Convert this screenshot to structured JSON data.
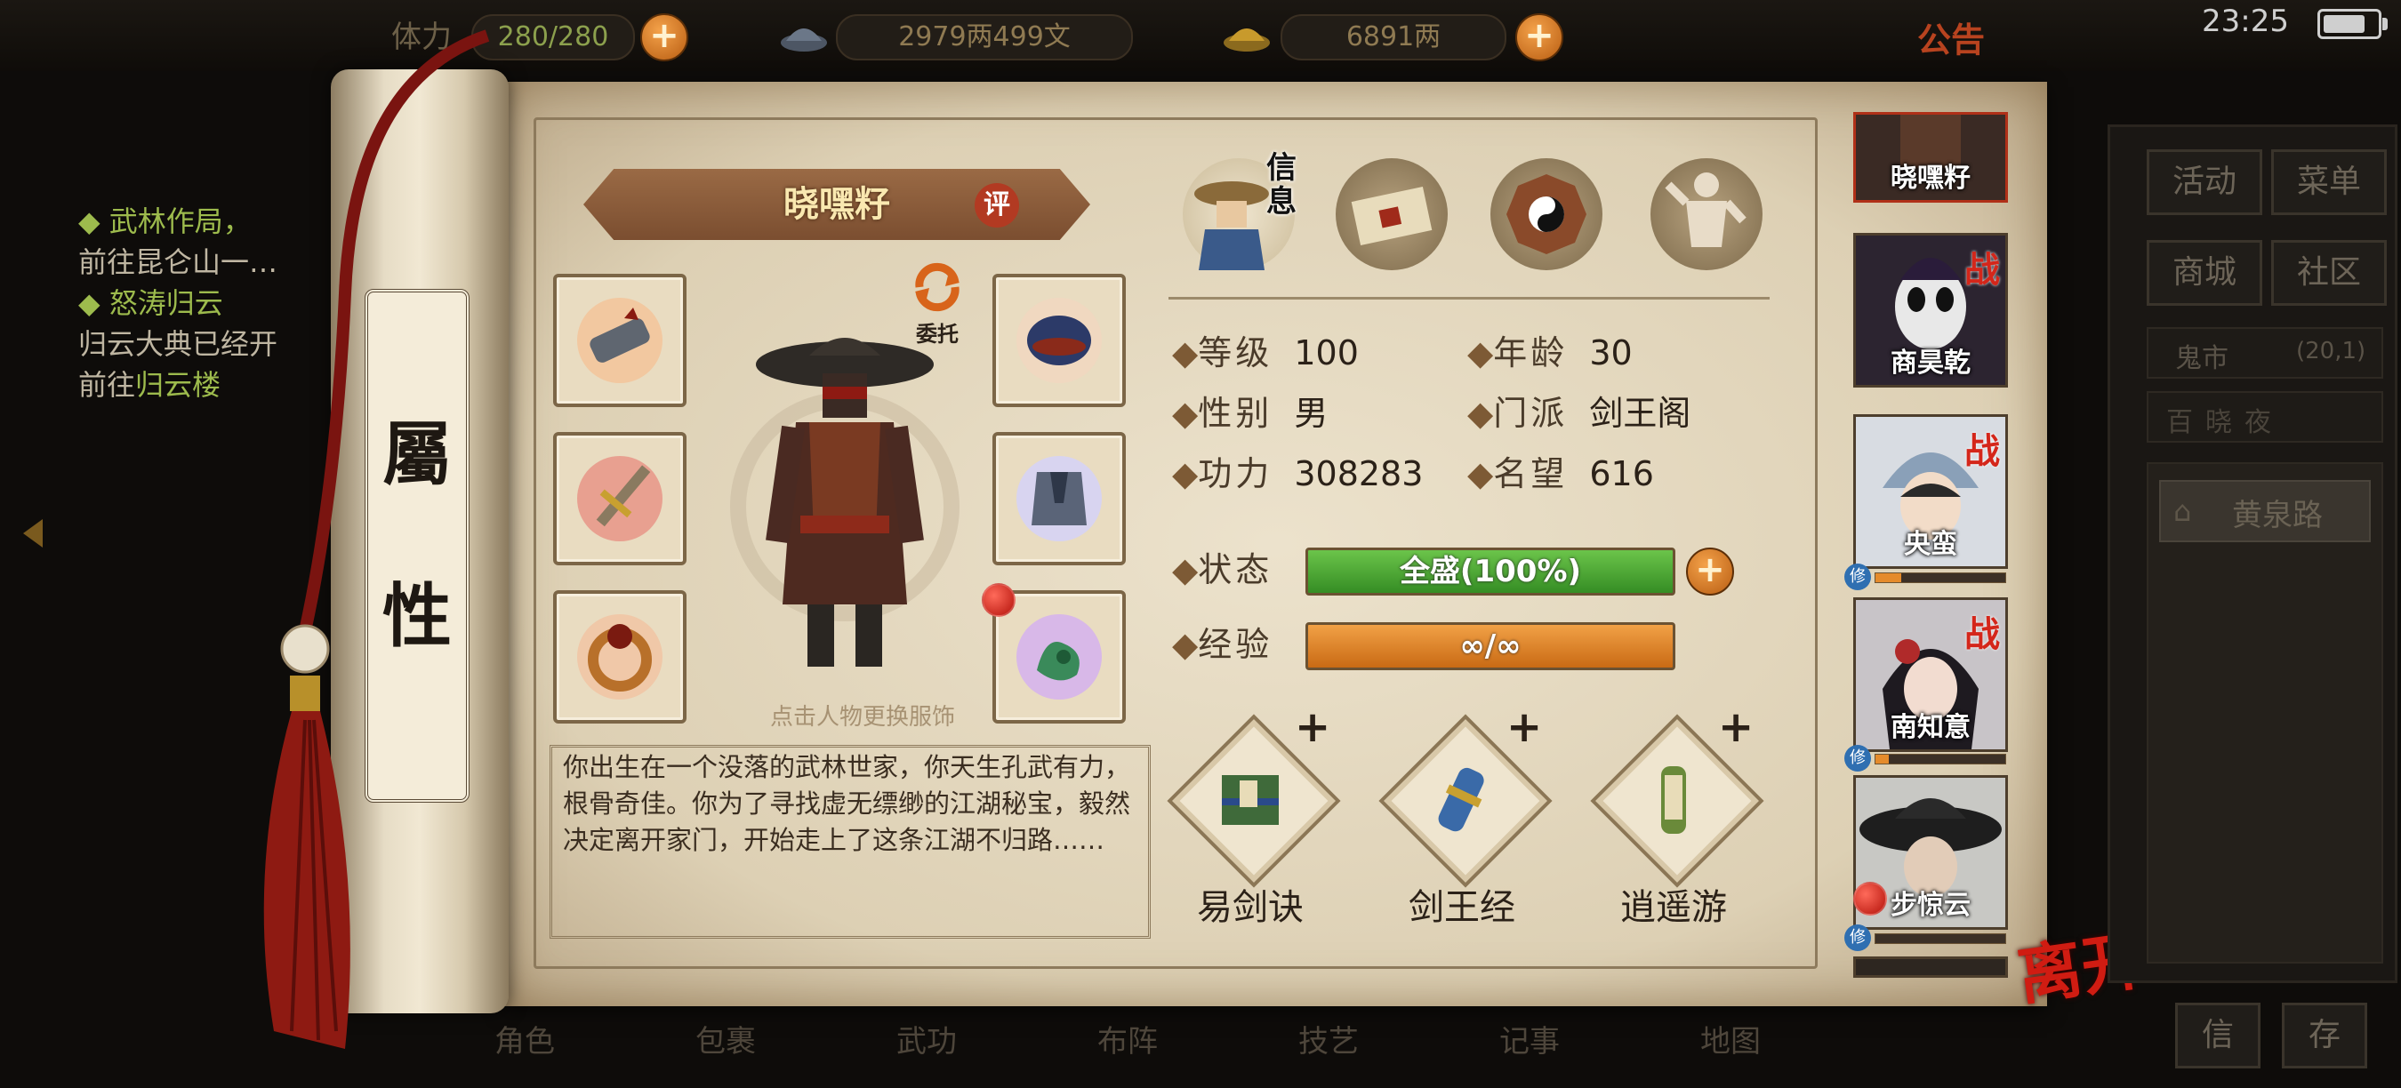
{
  "topbar": {
    "stamina_label": "体力",
    "stamina_value": "280/280",
    "silver_value": "2979两499文",
    "gold_value": "6891两",
    "announcement_label": "公告",
    "clock": "23:25"
  },
  "quests": [
    {
      "title": "武林作局，",
      "text": "前往昆仑山一…"
    },
    {
      "title": "怒涛归云",
      "text": "归云大典已经开",
      "link_prefix": "前往",
      "link": "归云楼"
    }
  ],
  "scroll": {
    "title_chars": [
      "屬",
      "性"
    ]
  },
  "character": {
    "name": "晓嘿籽",
    "rate_label": "评",
    "entrust_label": "委托",
    "hint": "点击人物更换服饰",
    "description": "你出生在一个没落的武林世家，你天生孔武有力，根骨奇佳。你为了寻找虚无缥缈的江湖秘宝，毅然决定离开家门，开始走上了这条江湖不归路……"
  },
  "tabs": [
    {
      "name": "info",
      "label": "信息"
    },
    {
      "name": "map",
      "label": ""
    },
    {
      "name": "bagua",
      "label": ""
    },
    {
      "name": "meridian",
      "label": ""
    }
  ],
  "stats": {
    "level_label": "等级",
    "level": "100",
    "age_label": "年龄",
    "age": "30",
    "gender_label": "性别",
    "gender": "男",
    "sect_label": "门派",
    "sect": "剑王阁",
    "power_label": "功力",
    "power": "308283",
    "fame_label": "名望",
    "fame": "616",
    "status_label": "状态",
    "status": "全盛(100%)",
    "status_fill": 1.0,
    "exp_label": "经验",
    "exp": "∞/∞",
    "exp_fill": 1.0
  },
  "skills": [
    {
      "name": "易剑诀"
    },
    {
      "name": "剑王经"
    },
    {
      "name": "逍遥游"
    }
  ],
  "party": [
    {
      "name": "晓嘿籽",
      "in_battle": false
    },
    {
      "name": "商昊乾",
      "in_battle": true
    },
    {
      "name": "央蛮",
      "in_battle": true,
      "cultivation": 0.2
    },
    {
      "name": "南知意",
      "in_battle": true,
      "cultivation": 0.1
    },
    {
      "name": "步惊云",
      "in_battle": false,
      "cultivation": 0.0
    }
  ],
  "cultivation_label": "修",
  "war_label": "战",
  "right_menu": {
    "activity": "活动",
    "menu": "菜单",
    "shop": "商城",
    "community": "社区",
    "ghost_market": "鬼市",
    "ghost_coords": "(20,1)",
    "faded_item": "百晓夜",
    "location": "黄泉路",
    "bottom_left": "信",
    "bottom_right": "存"
  },
  "leave_label": "离开",
  "bottom_nav": [
    "角色",
    "包裹",
    "武功",
    "布阵",
    "技艺",
    "记事",
    "地图"
  ],
  "colors": {
    "accent_orange": "#c96a14",
    "status_green": "#358d24",
    "war_red": "#d4261a"
  }
}
